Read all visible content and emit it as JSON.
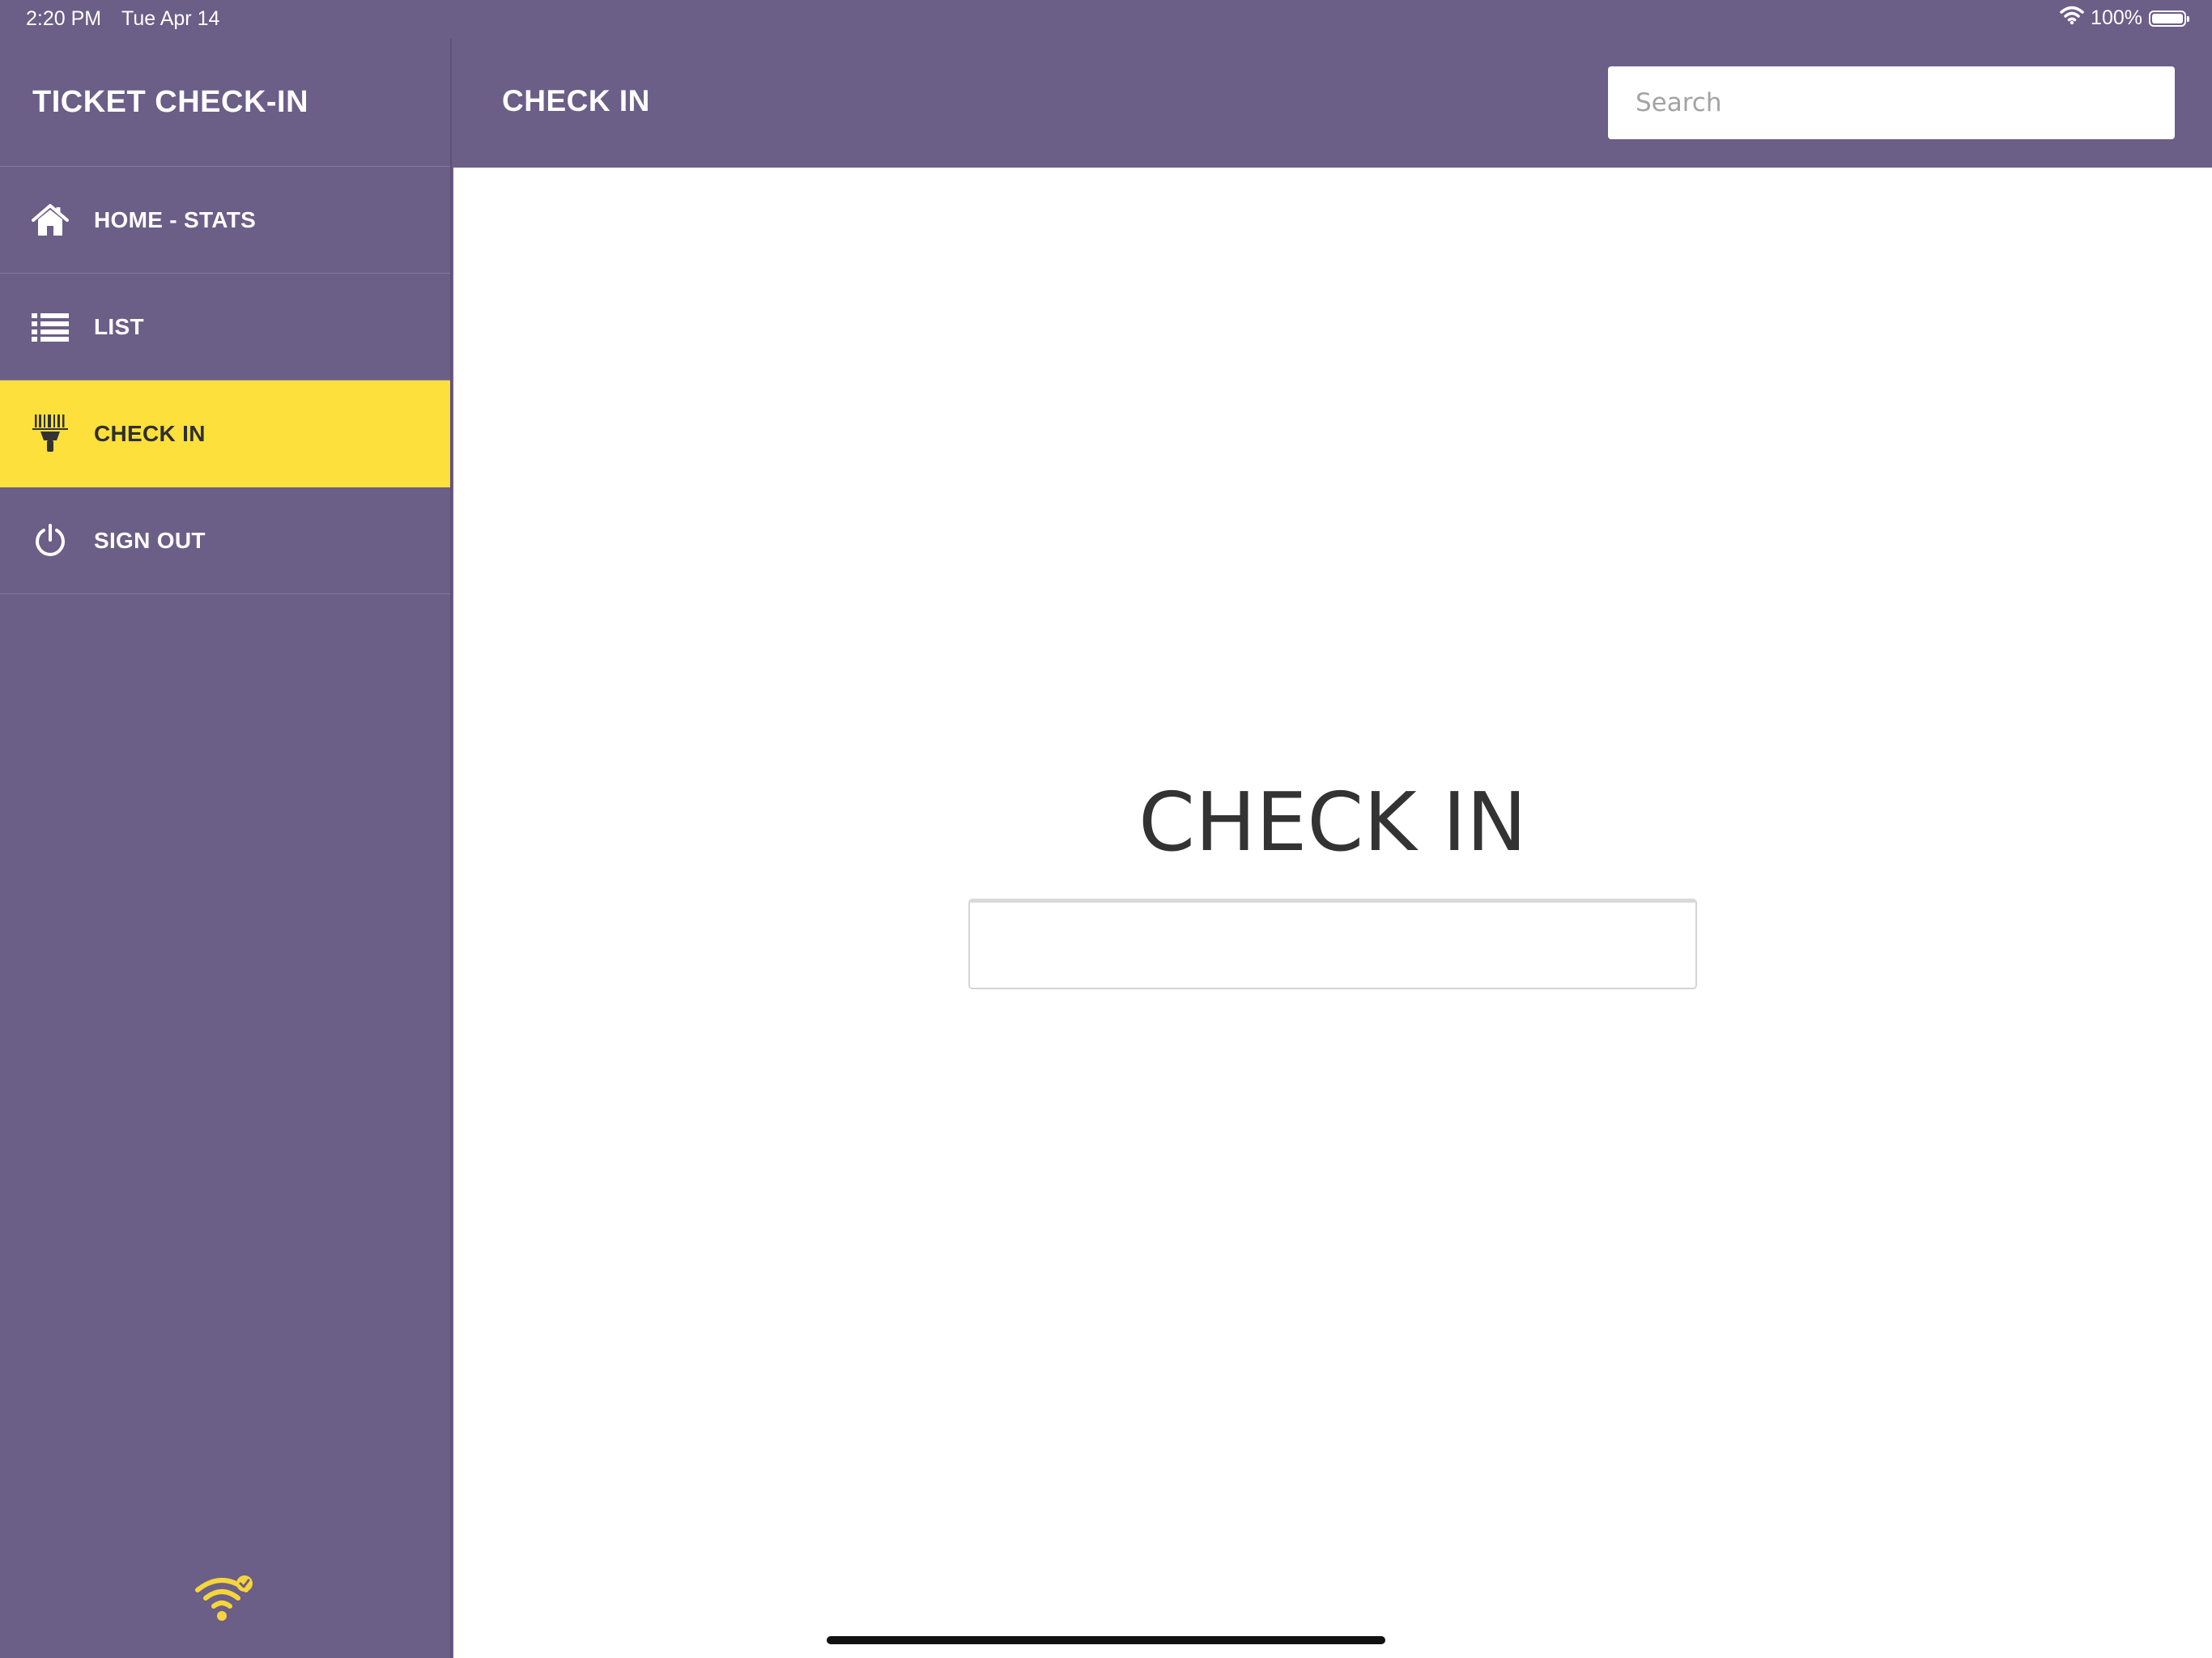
{
  "status_bar": {
    "time": "2:20 PM",
    "date": "Tue Apr 14",
    "battery_percent": "100%",
    "wifi_icon": "wifi-icon",
    "battery_icon": "battery-icon"
  },
  "sidebar": {
    "title": "TICKET CHECK-IN",
    "items": [
      {
        "label": "HOME - STATS",
        "icon": "home-icon",
        "active": false
      },
      {
        "label": "LIST",
        "icon": "list-icon",
        "active": false
      },
      {
        "label": "CHECK IN",
        "icon": "barcode-scanner-icon",
        "active": true
      },
      {
        "label": "SIGN OUT",
        "icon": "power-icon",
        "active": false
      }
    ],
    "connection_icon": "wifi-connected-icon"
  },
  "header": {
    "title": "CHECK IN",
    "search": {
      "placeholder": "Search",
      "value": ""
    }
  },
  "main": {
    "heading": "CHECK IN",
    "checkin_field": {
      "value": "",
      "placeholder": ""
    }
  },
  "colors": {
    "brand_purple": "#6b5e87",
    "active_yellow": "#fde03b",
    "icon_yellow": "#f6d53b"
  }
}
